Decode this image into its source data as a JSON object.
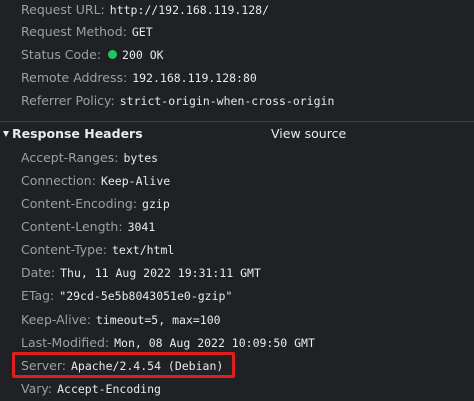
{
  "general": {
    "request_url": {
      "key": "Request URL:",
      "value": "http://192.168.119.128/"
    },
    "request_method": {
      "key": "Request Method:",
      "value": "GET"
    },
    "status_code": {
      "key": "Status Code:",
      "value": "200 OK",
      "status_color": "#22c55e"
    },
    "remote_address": {
      "key": "Remote Address:",
      "value": "192.168.119.128:80"
    },
    "referrer_policy": {
      "key": "Referrer Policy:",
      "value": "strict-origin-when-cross-origin"
    }
  },
  "response_headers": {
    "title": "Response Headers",
    "view_source": "View source",
    "expanded": true,
    "items": [
      {
        "key": "Accept-Ranges:",
        "value": "bytes"
      },
      {
        "key": "Connection:",
        "value": "Keep-Alive"
      },
      {
        "key": "Content-Encoding:",
        "value": "gzip"
      },
      {
        "key": "Content-Length:",
        "value": "3041"
      },
      {
        "key": "Content-Type:",
        "value": "text/html"
      },
      {
        "key": "Date:",
        "value": "Thu, 11 Aug 2022 19:31:11 GMT"
      },
      {
        "key": "ETag:",
        "value": "\"29cd-5e5b8043051e0-gzip\""
      },
      {
        "key": "Keep-Alive:",
        "value": "timeout=5, max=100"
      },
      {
        "key": "Last-Modified:",
        "value": "Mon, 08 Aug 2022 10:09:50 GMT"
      },
      {
        "key": "Server:",
        "value": "Apache/2.4.54 (Debian)"
      },
      {
        "key": "Vary:",
        "value": "Accept-Encoding"
      }
    ]
  },
  "colors": {
    "background": "#202124",
    "key_text": "#9aa0a6",
    "value_text": "#e8eaed",
    "highlight_border": "#e01e1e"
  },
  "icons": {
    "status": "status-dot-icon",
    "section_toggle": "triangle-down-icon"
  }
}
